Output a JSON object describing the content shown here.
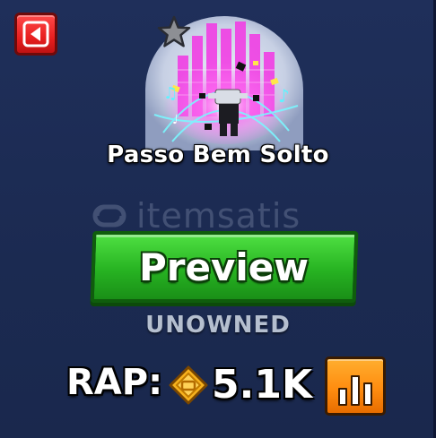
{
  "item": {
    "name": "Passo Bem Solto",
    "status": "UNOWNED"
  },
  "actions": {
    "preview_label": "Preview",
    "back_icon": "back-arrow-icon",
    "stats_icon": "bar-chart-icon"
  },
  "rap": {
    "label": "RAP:",
    "value": "5.1K",
    "currency_icon": "robux-coin-icon"
  },
  "watermark": {
    "text": "itemsatis"
  },
  "colors": {
    "background": "#1c2b53",
    "preview_green": "#27b322",
    "back_red": "#e81f1f",
    "stats_orange": "#ff8d10",
    "coin_gold": "#f7b21e",
    "status_gray": "#b5bfcf"
  }
}
